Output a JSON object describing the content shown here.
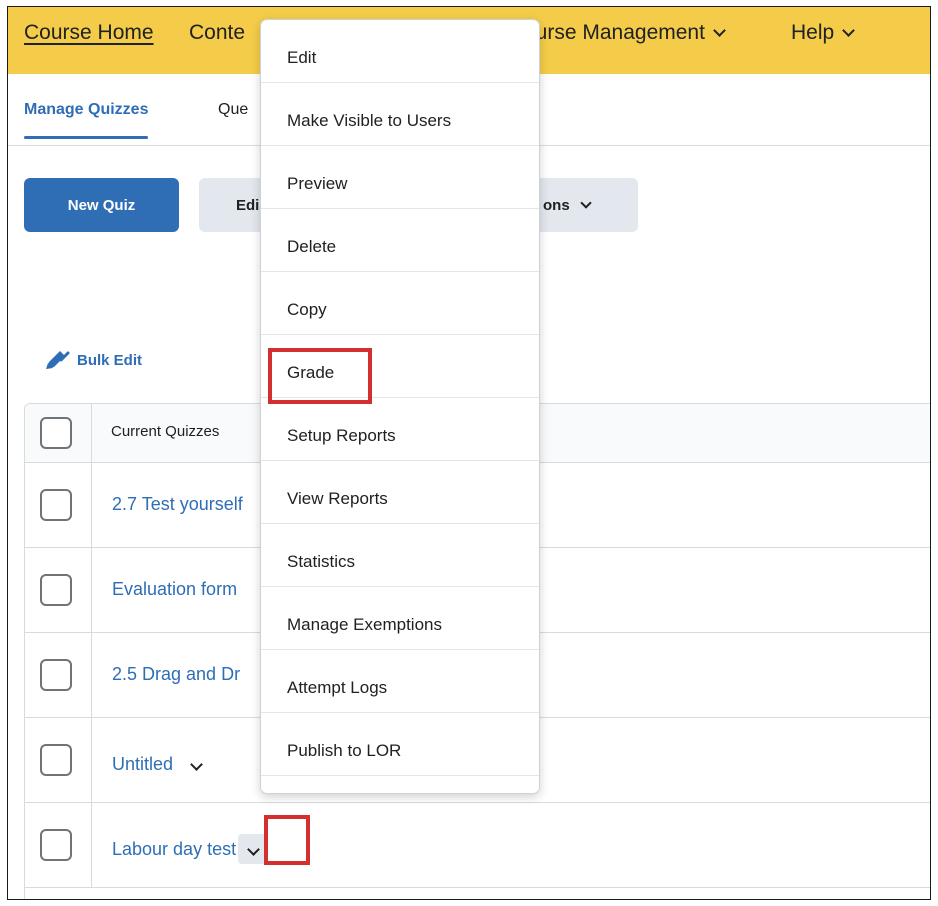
{
  "navbar": {
    "course_home": "Course Home",
    "content": "Conte",
    "course_management": "ourse Management",
    "help": "Help"
  },
  "tabs": {
    "manage_quizzes": "Manage Quizzes",
    "question_library": "Que"
  },
  "toolbar": {
    "new_quiz": "New Quiz",
    "edit": "Edi",
    "more_actions": "ons"
  },
  "bulk_edit": "Bulk Edit",
  "table": {
    "header": "Current Quizzes",
    "rows": [
      {
        "title": "2.7 Test yourself"
      },
      {
        "title": "Evaluation form"
      },
      {
        "title": "2.5 Drag and Dr"
      },
      {
        "title": "Untitled"
      },
      {
        "title": "Labour day test"
      }
    ]
  },
  "context_menu": {
    "items": [
      "Edit",
      "Make Visible to Users",
      "Preview",
      "Delete",
      "Copy",
      "Grade",
      "Setup Reports",
      "View Reports",
      "Statistics",
      "Manage Exemptions",
      "Attempt Logs",
      "Publish to LOR"
    ]
  },
  "colors": {
    "navbar": "#f5cc4a",
    "primary": "#2f6db5",
    "highlight": "#d32f2f"
  }
}
